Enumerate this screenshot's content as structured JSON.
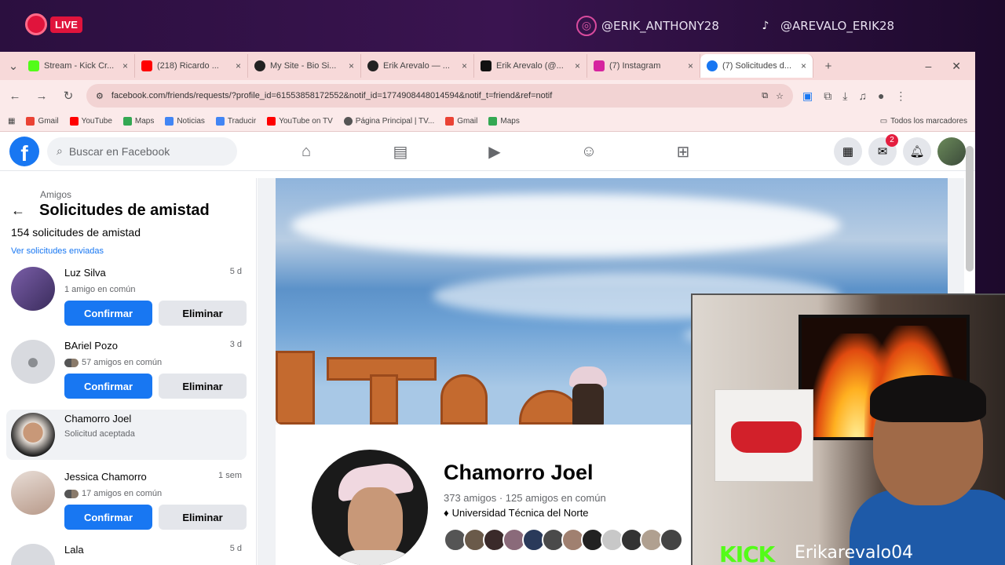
{
  "overlay": {
    "live": "LIVE",
    "social": [
      {
        "handle": "@ERIK_ANTHONY28",
        "icon": "instagram-icon"
      },
      {
        "handle": "@AREVALO_ERIK28",
        "icon": "tiktok-icon"
      }
    ],
    "kick_logo": "KICK",
    "kick_user": "Erikarevalo04"
  },
  "browser": {
    "tabs": [
      {
        "title": "Stream - Kick Cr...",
        "color": "#53fc18"
      },
      {
        "title": "(218) Ricardo ...",
        "color": "#ff0000"
      },
      {
        "title": "My Site - Bio Si...",
        "color": "#222222"
      },
      {
        "title": "Erik Arevalo — ...",
        "color": "#222222"
      },
      {
        "title": "Erik Arevalo (@...",
        "color": "#111111"
      },
      {
        "title": "(7) Instagram",
        "color": "#d6249f"
      },
      {
        "title": "(7) Solicitudes d...",
        "color": "#1877f2"
      }
    ],
    "url": "facebook.com/friends/requests/?profile_id=61553858172552&notif_id=1774908448014594&notif_t=friend&ref=notif",
    "bookmarks": [
      "Gmail",
      "YouTube",
      "Maps",
      "Noticias",
      "Traducir",
      "YouTube on TV",
      "Página Principal | TV...",
      "Gmail",
      "Maps"
    ],
    "bookmarks_all": "Todos los marcadores"
  },
  "facebook": {
    "search_placeholder": "Buscar en Facebook",
    "messenger_badge": "2"
  },
  "sidebar": {
    "breadcrumb": "Amigos",
    "title": "Solicitudes de amistad",
    "count": "154 solicitudes de amistad",
    "sent_link": "Ver solicitudes enviadas",
    "confirm": "Confirmar",
    "delete": "Eliminar",
    "requests": [
      {
        "name": "Luz Silva",
        "time": "5 d",
        "mutual": "1 amigo en común"
      },
      {
        "name": "BAriel Pozo",
        "time": "3 d",
        "mutual": "57 amigos en común"
      },
      {
        "name": "Chamorro Joel",
        "time": "",
        "mutual": "Solicitud aceptada"
      },
      {
        "name": "Jessica Chamorro",
        "time": "1 sem",
        "mutual": "17 amigos en común"
      },
      {
        "name": "Lala",
        "time": "5 d",
        "mutual": ""
      }
    ]
  },
  "profile": {
    "name": "Chamorro Joel",
    "friends": "373 amigos · 125 amigos en común",
    "education": "Universidad Técnica del Norte"
  }
}
